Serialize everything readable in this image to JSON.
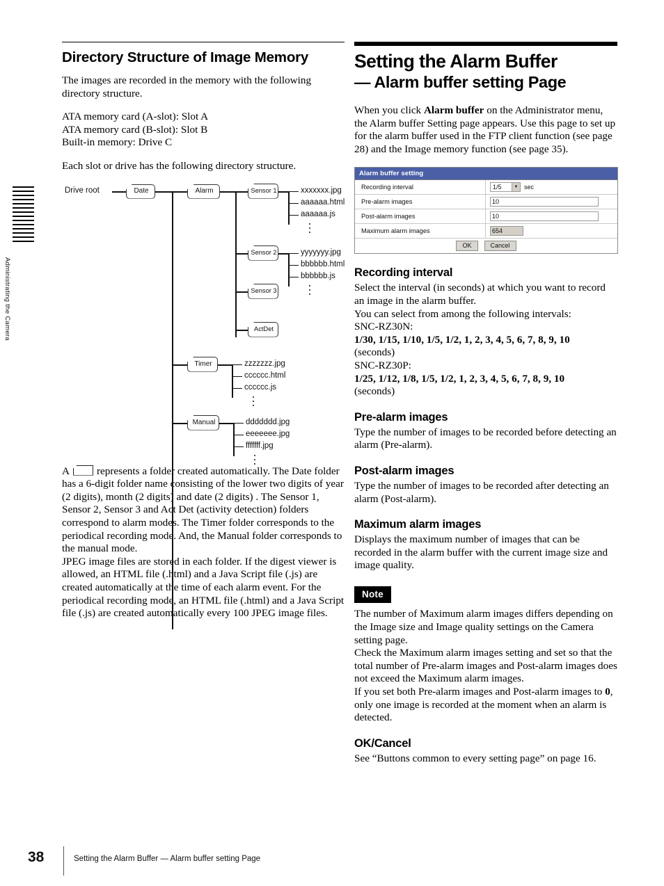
{
  "side_tab": {
    "label": "Administrating the Camera",
    "rule_count": 14
  },
  "left_column": {
    "heading": "Directory Structure of Image Memory",
    "intro": "The images are recorded in the memory with the following directory structure.",
    "slots": [
      "ATA memory card (A-slot): Slot A",
      "ATA memory card (B-slot): Slot B",
      "Built-in memory: Drive C"
    ],
    "each_slot_line": "Each slot or drive has the following directory structure.",
    "tree": {
      "root_label": "Drive root",
      "folders": {
        "date": "Date",
        "alarm": "Alarm",
        "sensor1": "Sensor 1",
        "sensor2": "Sensor 2",
        "sensor3": "Sensor 3",
        "actdet": "ActDet",
        "timer": "Timer",
        "manual": "Manual"
      },
      "files": {
        "sensor1": [
          "xxxxxxx.jpg",
          "aaaaaa.html",
          "aaaaaa.js"
        ],
        "sensor2": [
          "yyyyyyy.jpg",
          "bbbbbb.html",
          "bbbbbb.js"
        ],
        "timer": [
          "zzzzzzz.jpg",
          "cccccc.html",
          "cccccc.js"
        ],
        "manual": [
          "ddddddd.jpg",
          "eeeeeee.jpg",
          "fffffff.jpg"
        ]
      }
    },
    "explanation_1_prefix": "A",
    "explanation_1": "represents a folder created automatically.  The Date folder has a 6-digit folder name consisting of the lower two digits of year (2 digits), month (2 digits) and date (2 digits) .  The Sensor 1, Sensor 2, Sensor 3 and Act Det (activity detection) folders correspond to alarm modes. The Timer folder corresponds to the periodical recording mode.  And, the Manual folder corresponds to the manual mode.",
    "explanation_2": "JPEG image files are stored in each folder.  If the digest viewer is allowed, an HTML file (.html) and a Java Script file (.js) are created automatically at the time of each alarm event.  For the periodical recording mode, an HTML file (.html) and a Java Script file (.js) are created automatically every 100 JPEG image files."
  },
  "right_column": {
    "title_line1": "Setting the Alarm Buffer",
    "title_line2": "— Alarm buffer setting Page",
    "intro_part1": "When you click ",
    "intro_bold": "Alarm buffer",
    "intro_part2": " on the Administrator menu, the Alarm buffer Setting page appears.",
    "intro_line2": "Use this page to set up for the alarm buffer used in the FTP client function (see page 28) and the Image memory function (see page 35).",
    "form": {
      "title": "Alarm buffer setting",
      "accent_color": "#4a5fa5",
      "rows": [
        {
          "label": "Recording interval",
          "type": "select",
          "value": "1/5",
          "unit": "sec"
        },
        {
          "label": "Pre-alarm images",
          "type": "text",
          "value": "10"
        },
        {
          "label": "Post-alarm images",
          "type": "text",
          "value": "10"
        },
        {
          "label": "Maximum alarm images",
          "type": "readonly",
          "value": "654"
        }
      ],
      "ok_label": "OK",
      "cancel_label": "Cancel"
    },
    "sections": [
      {
        "heading": "Recording interval",
        "body_lines": [
          "Select the interval (in seconds) at which you want to record an image in the alarm buffer.",
          "You can select from among the following intervals:",
          "SNC-RZ30N:"
        ],
        "intervals_n": "1/30, 1/15, 1/10, 1/5, 1/2, 1, 2, 3, 4, 5, 6, 7, 8, 9, 10",
        "seconds_n": "(seconds)",
        "model_p": "SNC-RZ30P:",
        "intervals_p": "1/25, 1/12, 1/8, 1/5, 1/2, 1, 2, 3, 4, 5, 6, 7, 8, 9, 10",
        "seconds_p": "(seconds)"
      },
      {
        "heading": "Pre-alarm images",
        "body": "Type the number of images to be recorded before detecting an alarm (Pre-alarm)."
      },
      {
        "heading": "Post-alarm images",
        "body": "Type the number of images to be recorded after detecting an alarm (Post-alarm)."
      },
      {
        "heading": "Maximum alarm images",
        "body": "Displays the maximum number of images that can be recorded in the alarm buffer with the current image size and image quality."
      }
    ],
    "note": {
      "badge": "Note",
      "para1": "The number of Maximum alarm images differs depending on the Image size and Image quality settings on the Camera setting page.",
      "para2": "Check the Maximum alarm images setting and set so that the total number of Pre-alarm images and Post-alarm images does not exceed the Maximum alarm images.",
      "para3_a": "If you set both Pre-alarm images and Post-alarm images to ",
      "para3_bold": "0",
      "para3_b": ", only one image is recorded at the moment when an alarm is detected."
    },
    "ok_cancel": {
      "heading": "OK/Cancel",
      "body": "See “Buttons common to every setting page” on page 16."
    }
  },
  "footer": {
    "page_number": "38",
    "text": "Setting the Alarm Buffer — Alarm buffer setting Page"
  }
}
